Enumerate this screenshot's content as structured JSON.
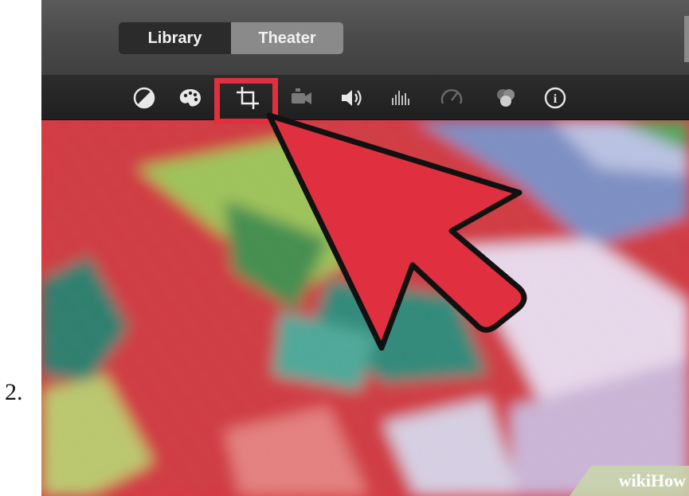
{
  "step": {
    "number": "2."
  },
  "app": {
    "tabs": [
      {
        "label": "Library",
        "selected": false
      },
      {
        "label": "Theater",
        "selected": true
      }
    ]
  },
  "toolbar": {
    "icons": [
      "color-balance-icon",
      "palette-icon",
      "crop-icon",
      "stabilization-icon",
      "volume-icon",
      "equalizer-icon",
      "speed-icon",
      "filters-icon",
      "info-icon"
    ],
    "active": "crop-icon",
    "info_glyph": "i"
  },
  "annotation": {
    "arrow_color": "#e0303f",
    "highlight_color": "#e0303f"
  },
  "watermark": {
    "part1": "wiki",
    "part2": "How"
  }
}
